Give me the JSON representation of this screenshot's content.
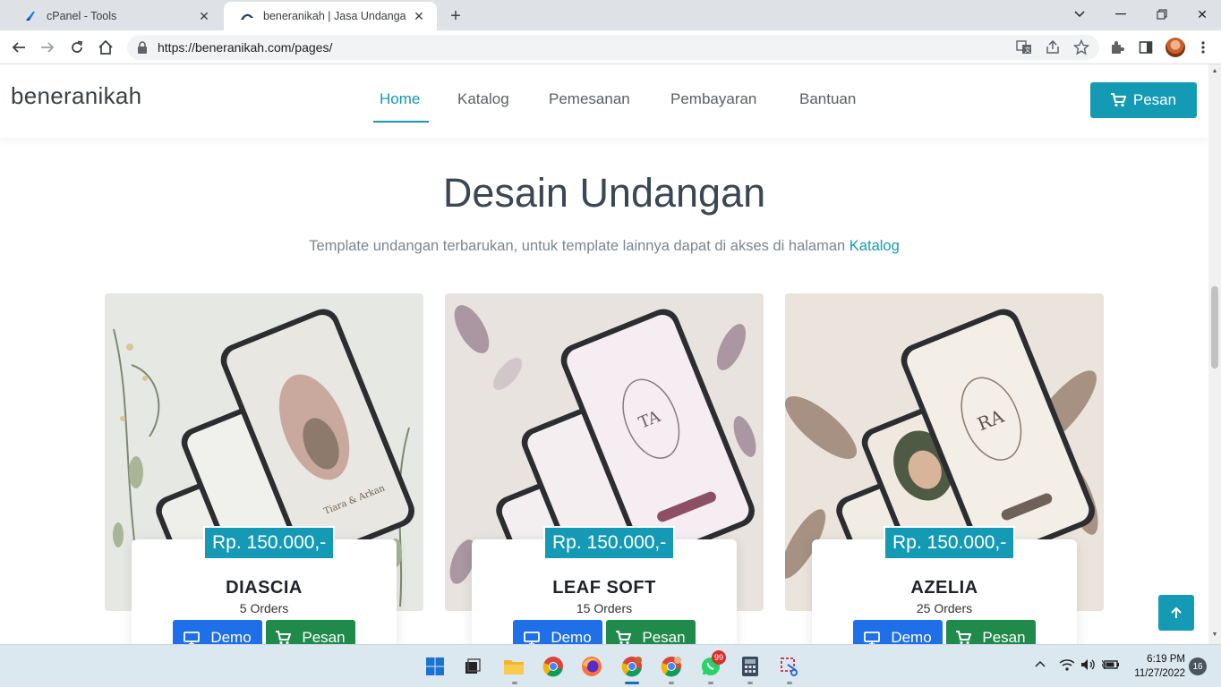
{
  "browser": {
    "tabs": [
      {
        "title": "cPanel - Tools",
        "active": false
      },
      {
        "title": "beneranikah | Jasa Undangan Pernikahan",
        "active": true
      }
    ],
    "url": "https://beneranikah.com/pages/"
  },
  "site": {
    "brand": "beneranikah",
    "nav": [
      {
        "label": "Home",
        "active": true
      },
      {
        "label": "Katalog",
        "active": false
      },
      {
        "label": "Pemesanan",
        "active": false
      },
      {
        "label": "Pembayaran",
        "active": false
      },
      {
        "label": "Bantuan",
        "active": false
      }
    ],
    "order_button": "Pesan"
  },
  "section": {
    "title": "Desain Undangan",
    "subtitle": "Template undangan terbarukan, untuk template lainnya dapat di akses di halaman",
    "subtitle_link": "Katalog"
  },
  "products": [
    {
      "name": "DIASCIA",
      "price": "Rp. 150.000,-",
      "orders": "5 Orders",
      "demo_label": "Demo",
      "order_label": "Pesan"
    },
    {
      "name": "LEAF SOFT",
      "price": "Rp. 150.000,-",
      "orders": "15 Orders",
      "demo_label": "Demo",
      "order_label": "Pesan"
    },
    {
      "name": "AZELIA",
      "price": "Rp. 150.000,-",
      "orders": "25 Orders",
      "demo_label": "Demo",
      "order_label": "Pesan"
    }
  ],
  "taskbar": {
    "time": "6:19 PM",
    "date": "11/27/2022",
    "notifications": "16",
    "whatsapp_badge": "99"
  },
  "colors": {
    "accent": "#149ab5",
    "demo_button": "#1e6fe8",
    "order_button": "#1f8a4a"
  }
}
